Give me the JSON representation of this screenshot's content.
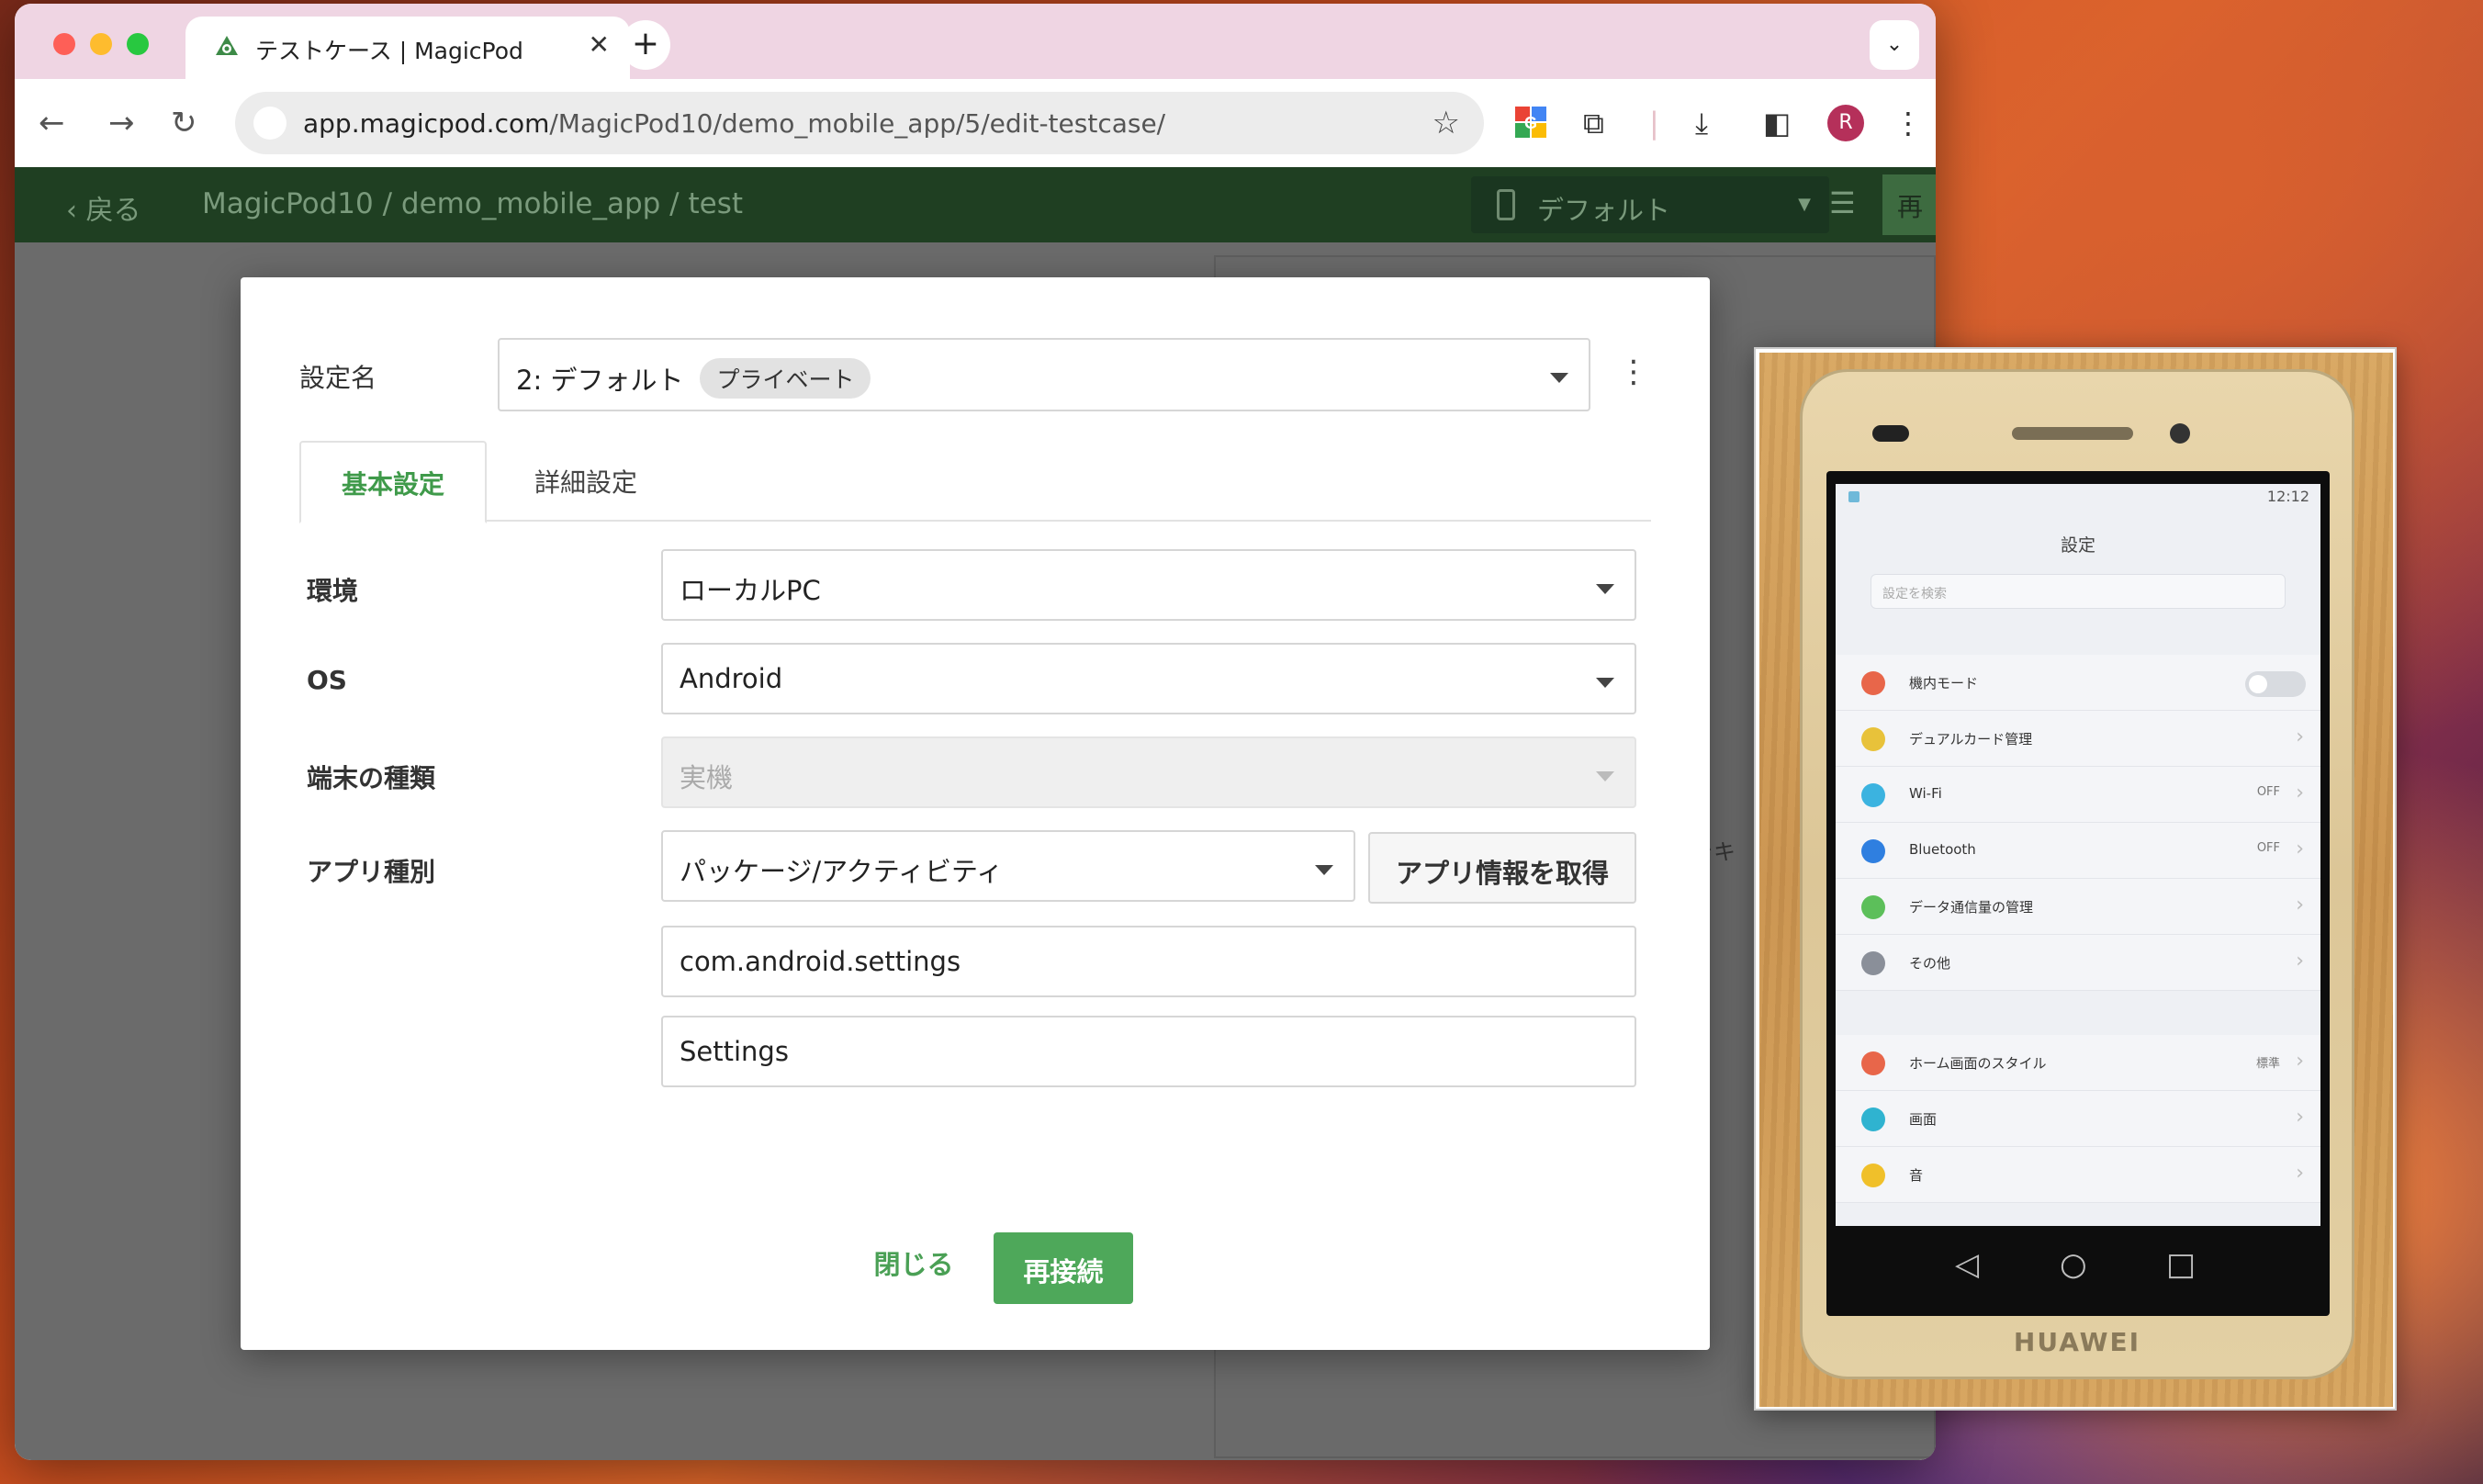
{
  "browser": {
    "tab_title": "テストケース | MagicPod",
    "url_host": "app.magicpod.com",
    "url_path": "/MagicPod10/demo_mobile_app/5/edit-testcase/",
    "profile_initial": "R"
  },
  "app": {
    "back_label": "戻る",
    "breadcrumb": "MagicPod10 / demo_mobile_app / test",
    "profile_select": "デフォルト",
    "run_button": "再",
    "bg_text": "をキ"
  },
  "dialog": {
    "config_label": "設定名",
    "config_value": "2: デフォルト",
    "config_chip": "プライベート",
    "tabs": [
      {
        "label": "基本設定",
        "active": true
      },
      {
        "label": "詳細設定",
        "active": false
      }
    ],
    "fields": {
      "env_label": "環境",
      "env_value": "ローカルPC",
      "os_label": "OS",
      "os_value": "Android",
      "device_type_label": "端末の種類",
      "device_type_value": "実機",
      "app_type_label": "アプリ種別",
      "app_type_value": "パッケージ/アクティビティ",
      "fetch_app_info_button": "アプリ情報を取得",
      "package_value": "com.android.settings",
      "activity_value": "Settings"
    },
    "close_button": "閉じる",
    "reconnect_button": "再接続"
  },
  "phone": {
    "status_time": "12:12",
    "screen_title": "設定",
    "search_placeholder": "設定を検索",
    "items": [
      {
        "label": "機内モード",
        "value": "",
        "color": "#e8664a",
        "toggle": true
      },
      {
        "label": "デュアルカード管理",
        "value": "",
        "color": "#e8c23a",
        "toggle": false
      },
      {
        "label": "Wi-Fi",
        "value": "OFF",
        "color": "#3bb3e0",
        "toggle": false
      },
      {
        "label": "Bluetooth",
        "value": "OFF",
        "color": "#2f7fe0",
        "toggle": false
      },
      {
        "label": "データ通信量の管理",
        "value": "",
        "color": "#5cbf5a",
        "toggle": false
      },
      {
        "label": "その他",
        "value": "",
        "color": "#8a8f99",
        "toggle": false
      }
    ],
    "items2": [
      {
        "label": "ホーム画面のスタイル",
        "value": "標準",
        "color": "#e8664a"
      },
      {
        "label": "画面",
        "value": "",
        "color": "#2fb3d0"
      },
      {
        "label": "音",
        "value": "",
        "color": "#f0c02a"
      }
    ],
    "brand": "HUAWEI"
  }
}
